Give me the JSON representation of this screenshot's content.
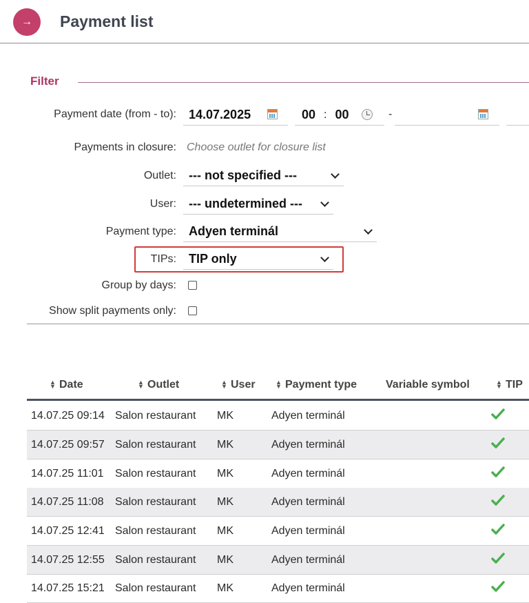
{
  "header": {
    "title": "Payment list",
    "back_icon": "→"
  },
  "filter": {
    "title": "Filter",
    "payment_date": {
      "label": "Payment date (from - to):",
      "from_date": "14.07.2025",
      "from_hour": "00",
      "from_min": "00",
      "time_sep": ":",
      "range_sep": "-"
    },
    "closure": {
      "label": "Payments in closure:",
      "placeholder": "Choose outlet for closure list"
    },
    "outlet": {
      "label": "Outlet:",
      "value": "--- not specified ---"
    },
    "user": {
      "label": "User:",
      "value": "--- undetermined ---"
    },
    "payment_type": {
      "label": "Payment type:",
      "value": "Adyen terminál"
    },
    "tips": {
      "label": "TIPs:",
      "value": "TIP only"
    },
    "group_by_days": {
      "label": "Group by days:"
    },
    "split_only": {
      "label": "Show split payments only:"
    }
  },
  "table": {
    "columns": [
      "Date",
      "Outlet",
      "User",
      "Payment type",
      "Variable symbol",
      "TIP"
    ],
    "rows": [
      {
        "date": "14.07.25 09:14",
        "outlet": "Salon restaurant",
        "user": "MK",
        "type": "Adyen terminál"
      },
      {
        "date": "14.07.25 09:57",
        "outlet": "Salon restaurant",
        "user": "MK",
        "type": "Adyen terminál"
      },
      {
        "date": "14.07.25 11:01",
        "outlet": "Salon restaurant",
        "user": "MK",
        "type": "Adyen terminál"
      },
      {
        "date": "14.07.25 11:08",
        "outlet": "Salon restaurant",
        "user": "MK",
        "type": "Adyen terminál"
      },
      {
        "date": "14.07.25 12:41",
        "outlet": "Salon restaurant",
        "user": "MK",
        "type": "Adyen terminál"
      },
      {
        "date": "14.07.25 12:55",
        "outlet": "Salon restaurant",
        "user": "MK",
        "type": "Adyen terminál"
      },
      {
        "date": "14.07.25 15:21",
        "outlet": "Salon restaurant",
        "user": "MK",
        "type": "Adyen terminál"
      }
    ]
  },
  "colors": {
    "accent": "#c2406a",
    "highlight": "#d23a3a",
    "check": "#4caf50"
  }
}
